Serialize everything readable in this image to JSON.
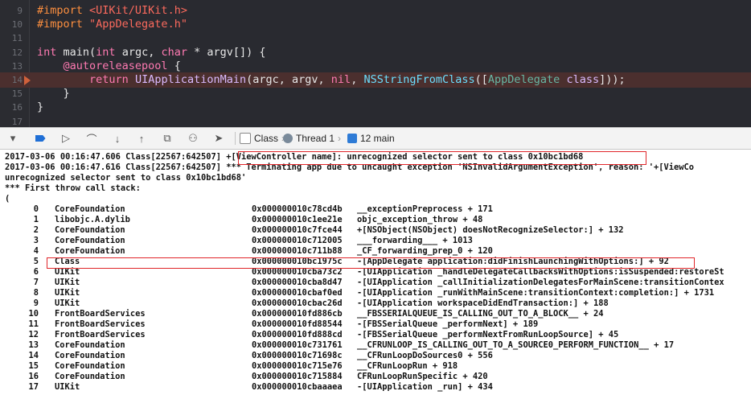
{
  "editor": {
    "lines": [
      {
        "num": "9",
        "segments": [
          {
            "t": "#import ",
            "c": "pre"
          },
          {
            "t": "<UIKit/UIKit.h>",
            "c": "str"
          }
        ]
      },
      {
        "num": "10",
        "segments": [
          {
            "t": "#import ",
            "c": "pre"
          },
          {
            "t": "\"AppDelegate.h\"",
            "c": "str"
          }
        ]
      },
      {
        "num": "11",
        "segments": []
      },
      {
        "num": "12",
        "segments": [
          {
            "t": "int",
            "c": "k"
          },
          {
            "t": " main(",
            "c": ""
          },
          {
            "t": "int",
            "c": "k"
          },
          {
            "t": " argc, ",
            "c": ""
          },
          {
            "t": "char",
            "c": "k"
          },
          {
            "t": " * argv[]) {",
            "c": ""
          }
        ]
      },
      {
        "num": "13",
        "segments": [
          {
            "t": "    ",
            "c": ""
          },
          {
            "t": "@autoreleasepool",
            "c": "k"
          },
          {
            "t": " {",
            "c": ""
          }
        ]
      },
      {
        "num": "14",
        "highlight": true,
        "segments": [
          {
            "t": "        ",
            "c": ""
          },
          {
            "t": "return",
            "c": "k"
          },
          {
            "t": " ",
            "c": ""
          },
          {
            "t": "UIApplicationMain",
            "c": "ty"
          },
          {
            "t": "(argc, argv, ",
            "c": ""
          },
          {
            "t": "nil",
            "c": "k"
          },
          {
            "t": ", ",
            "c": ""
          },
          {
            "t": "NSStringFromClass",
            "c": "cls"
          },
          {
            "t": "([",
            "c": ""
          },
          {
            "t": "AppDelegate",
            "c": "fn"
          },
          {
            "t": " ",
            "c": ""
          },
          {
            "t": "class",
            "c": "ty"
          },
          {
            "t": "]));",
            "c": ""
          }
        ]
      },
      {
        "num": "15",
        "segments": [
          {
            "t": "    }",
            "c": ""
          }
        ]
      },
      {
        "num": "16",
        "segments": [
          {
            "t": "}",
            "c": ""
          }
        ]
      },
      {
        "num": "17",
        "segments": []
      }
    ]
  },
  "debug_bar": {
    "breadcrumb_class": "Class",
    "breadcrumb_thread": "Thread 1",
    "breadcrumb_frame": "12 main"
  },
  "console": {
    "log_lines": [
      "2017-03-06 00:16:47.606 Class[22567:642507] +[ViewController name]: unrecognized selector sent to class 0x10bc1bd68",
      "2017-03-06 00:16:47.616 Class[22567:642507] *** Terminating app due to uncaught exception 'NSInvalidArgumentException', reason: '+[ViewCo",
      "unrecognized selector sent to class 0x10bc1bd68'",
      "*** First throw call stack:",
      "("
    ],
    "frames": [
      {
        "idx": "0",
        "lib": "CoreFoundation",
        "addr": "0x000000010c78cd4b",
        "sym": "__exceptionPreprocess + 171"
      },
      {
        "idx": "1",
        "lib": "libobjc.A.dylib",
        "addr": "0x000000010c1ee21e",
        "sym": "objc_exception_throw + 48"
      },
      {
        "idx": "2",
        "lib": "CoreFoundation",
        "addr": "0x000000010c7fce44",
        "sym": "+[NSObject(NSObject) doesNotRecognizeSelector:] + 132"
      },
      {
        "idx": "3",
        "lib": "CoreFoundation",
        "addr": "0x000000010c712005",
        "sym": "___forwarding___ + 1013"
      },
      {
        "idx": "4",
        "lib": "CoreFoundation",
        "addr": "0x000000010c711b88",
        "sym": "_CF_forwarding_prep_0 + 120"
      },
      {
        "idx": "5",
        "lib": "Class",
        "addr": "0x000000010bc1975c",
        "sym": "-[AppDelegate application:didFinishLaunchingWithOptions:] + 92"
      },
      {
        "idx": "6",
        "lib": "UIKit",
        "addr": "0x000000010cba73c2",
        "sym": "-[UIApplication _handleDelegateCallbacksWithOptions:isSuspended:restoreSt"
      },
      {
        "idx": "7",
        "lib": "UIKit",
        "addr": "0x000000010cba8d47",
        "sym": "-[UIApplication _callInitializationDelegatesForMainScene:transitionContex"
      },
      {
        "idx": "8",
        "lib": "UIKit",
        "addr": "0x000000010cbaf0ed",
        "sym": "-[UIApplication _runWithMainScene:transitionContext:completion:] + 1731"
      },
      {
        "idx": "9",
        "lib": "UIKit",
        "addr": "0x000000010cbac26d",
        "sym": "-[UIApplication workspaceDidEndTransaction:] + 188"
      },
      {
        "idx": "10",
        "lib": "FrontBoardServices",
        "addr": "0x000000010fd886cb",
        "sym": "__FBSSERIALQUEUE_IS_CALLING_OUT_TO_A_BLOCK__ + 24"
      },
      {
        "idx": "11",
        "lib": "FrontBoardServices",
        "addr": "0x000000010fd88544",
        "sym": "-[FBSSerialQueue _performNext] + 189"
      },
      {
        "idx": "12",
        "lib": "FrontBoardServices",
        "addr": "0x000000010fd888cd",
        "sym": "-[FBSSerialQueue _performNextFromRunLoopSource] + 45"
      },
      {
        "idx": "13",
        "lib": "CoreFoundation",
        "addr": "0x000000010c731761",
        "sym": "__CFRUNLOOP_IS_CALLING_OUT_TO_A_SOURCE0_PERFORM_FUNCTION__ + 17"
      },
      {
        "idx": "14",
        "lib": "CoreFoundation",
        "addr": "0x000000010c71698c",
        "sym": "__CFRunLoopDoSources0 + 556"
      },
      {
        "idx": "15",
        "lib": "CoreFoundation",
        "addr": "0x000000010c715e76",
        "sym": "__CFRunLoopRun + 918"
      },
      {
        "idx": "16",
        "lib": "CoreFoundation",
        "addr": "0x000000010c715884",
        "sym": "CFRunLoopRunSpecific + 420"
      },
      {
        "idx": "17",
        "lib": "UIKit",
        "addr": "0x000000010cbaaaea",
        "sym": "-[UIApplication _run] + 434"
      }
    ]
  },
  "colors": {
    "editor_bg": "#292a30",
    "highlight_line": "#4b2f2e",
    "annotation_box": "#e0262a"
  }
}
